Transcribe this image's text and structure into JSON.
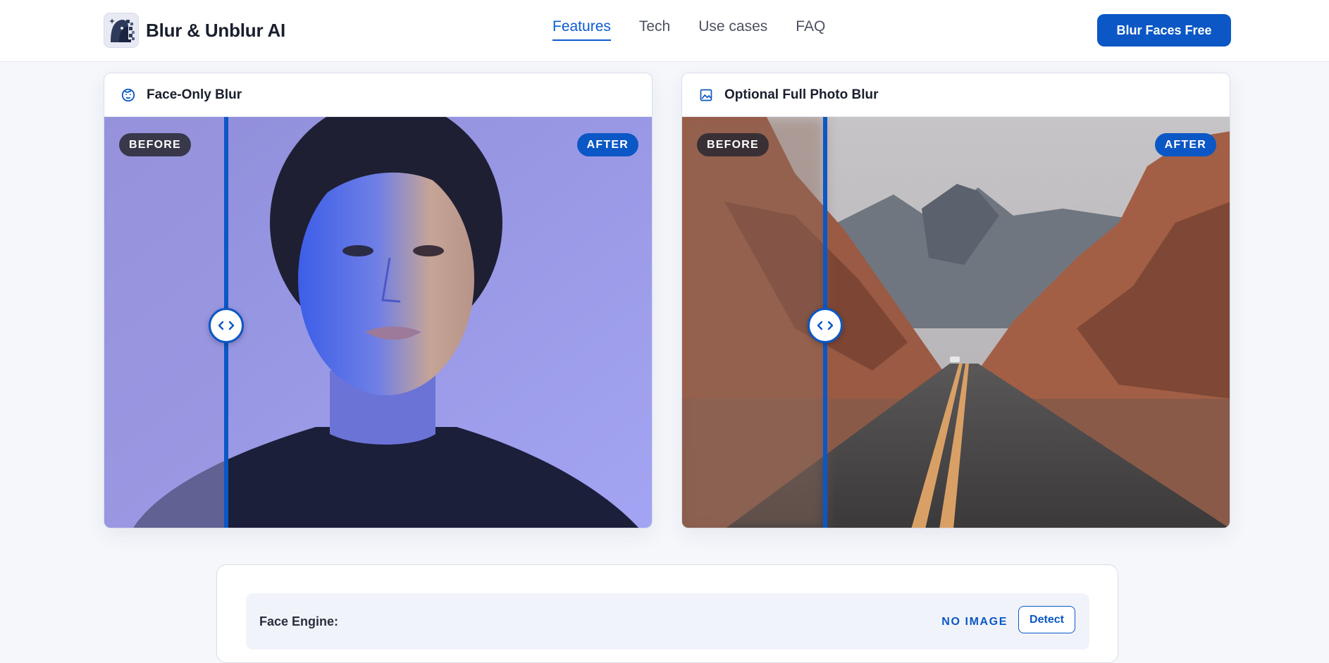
{
  "header": {
    "brand_name": "Blur & Unblur AI",
    "logo_icon": "pixel-face-icon",
    "nav": [
      {
        "label": "Features",
        "active": true
      },
      {
        "label": "Tech",
        "active": false
      },
      {
        "label": "Use cases",
        "active": false
      },
      {
        "label": "FAQ",
        "active": false
      }
    ],
    "cta_label": "Blur Faces Free"
  },
  "cards": [
    {
      "title": "Face-Only Blur",
      "icon": "face-icon",
      "before_label": "BEFORE",
      "after_label": "AFTER",
      "slider_position": 0.22
    },
    {
      "title": "Optional Full Photo Blur",
      "icon": "image-icon",
      "before_label": "BEFORE",
      "after_label": "AFTER",
      "slider_position": 0.26
    }
  ],
  "engine": {
    "label": "Face Engine:",
    "status": "NO IMAGE",
    "detect_label": "Detect"
  },
  "colors": {
    "accent": "#0b57c5",
    "badge_dark": "#2a2a30",
    "page_bg": "#f5f7fb"
  }
}
